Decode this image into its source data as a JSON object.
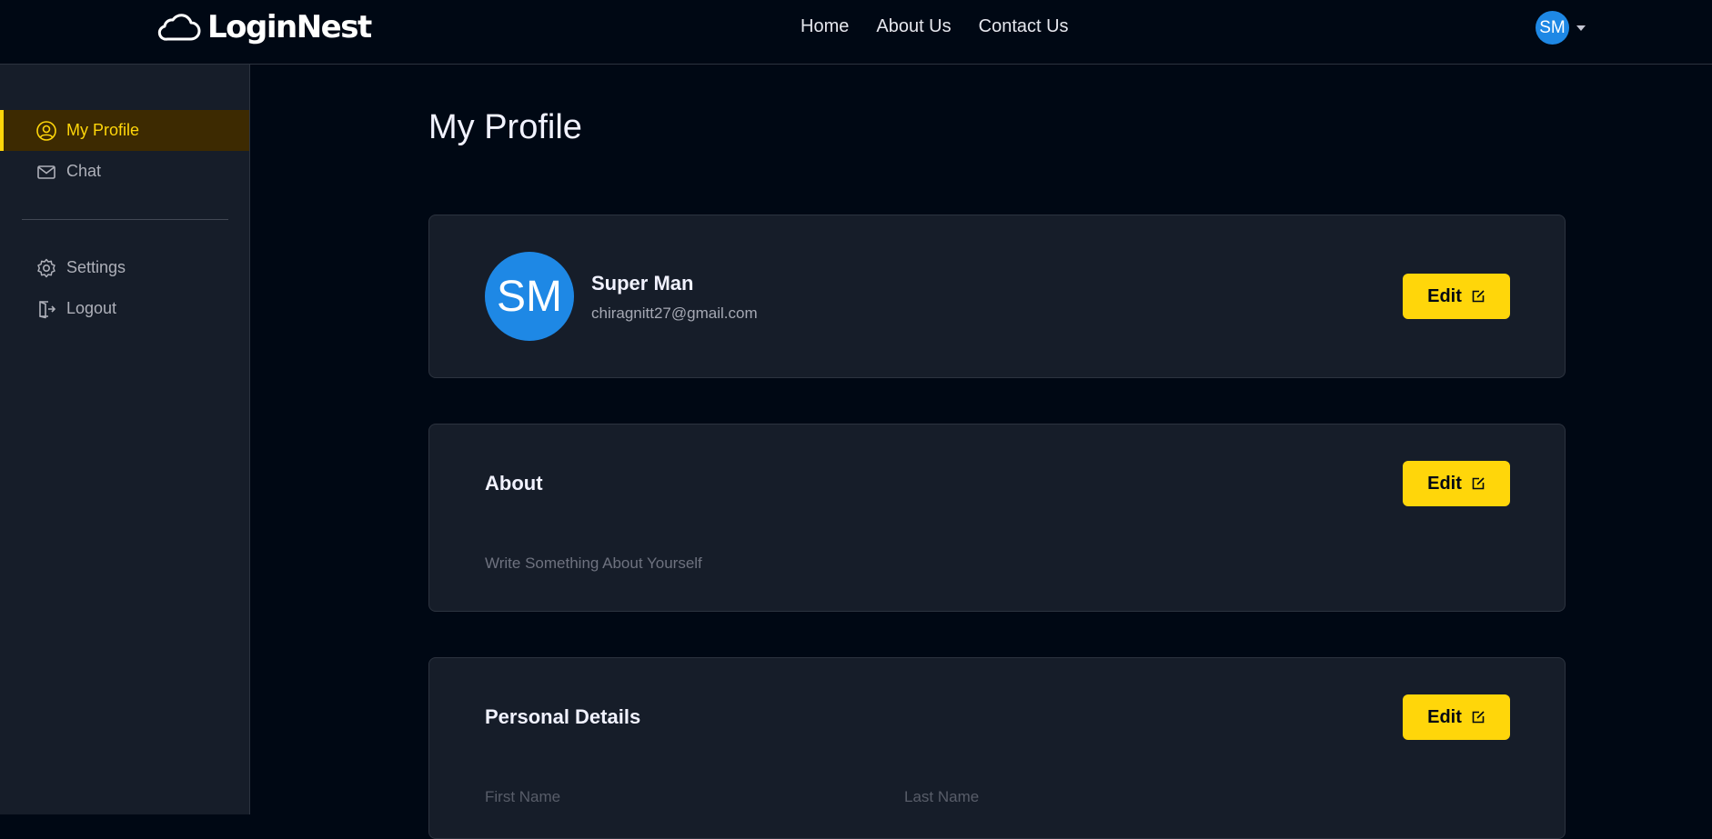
{
  "brand": {
    "name": "LoginNest",
    "logo_icon": "cloud-icon"
  },
  "nav": {
    "links": [
      "Home",
      "About Us",
      "Contact Us"
    ]
  },
  "user_menu": {
    "initials": "SM",
    "dropdown_icon": "caret-down-icon"
  },
  "sidebar": {
    "items": [
      {
        "label": "My Profile",
        "icon": "user-circle-icon",
        "active": true
      },
      {
        "label": "Chat",
        "icon": "mail-icon",
        "active": false
      }
    ],
    "bottom_items": [
      {
        "label": "Settings",
        "icon": "gear-icon"
      },
      {
        "label": "Logout",
        "icon": "logout-icon"
      }
    ]
  },
  "main": {
    "title": "My Profile",
    "profile_card": {
      "initials": "SM",
      "name": "Super Man",
      "email": "chiragnitt27@gmail.com",
      "edit_label": "Edit"
    },
    "about_card": {
      "title": "About",
      "text": "Write Something About Yourself",
      "edit_label": "Edit"
    },
    "personal_card": {
      "title": "Personal Details",
      "edit_label": "Edit",
      "fields": [
        {
          "label": "First Name"
        },
        {
          "label": "Last Name"
        }
      ]
    }
  },
  "colors": {
    "background": "#000814",
    "sidebar": "#161d29",
    "accent": "#ffd60a",
    "avatar": "#1e88e5",
    "active_item_bg": "#3d2a01"
  }
}
